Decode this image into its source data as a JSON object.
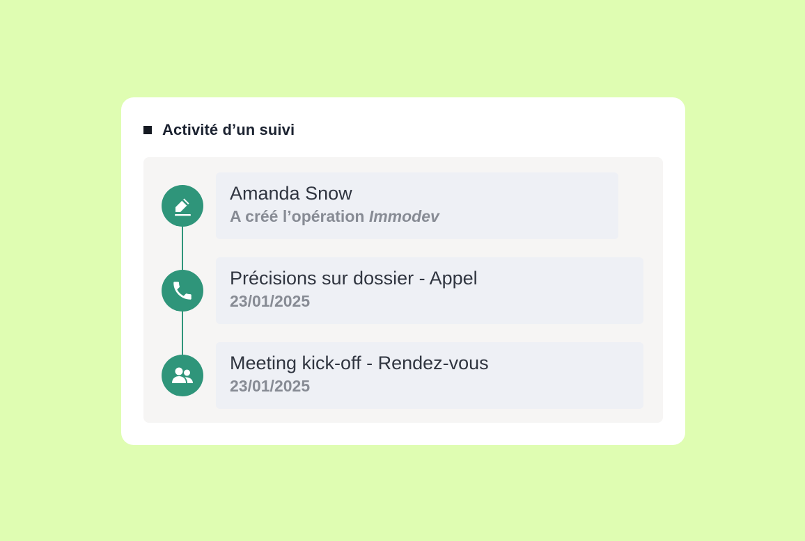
{
  "card": {
    "title": "Activité d’un suivi"
  },
  "timeline": {
    "items": [
      {
        "icon": "pencil-icon",
        "title": "Amanda Snow",
        "subtitle_prefix": "A créé l’opération ",
        "subtitle_emphasis": "Immodev"
      },
      {
        "icon": "phone-icon",
        "title": "Précisions sur dossier - Appel",
        "subtitle": "23/01/2025"
      },
      {
        "icon": "users-icon",
        "title": "Meeting kick-off - Rendez-vous",
        "subtitle": "23/01/2025"
      }
    ]
  },
  "colors": {
    "background": "#dffdb2",
    "accent": "#2f957a",
    "entry_background": "#eef0f5",
    "panel_background": "#f6f5f4",
    "title_text": "#303540",
    "subtitle_text": "#878b94"
  }
}
